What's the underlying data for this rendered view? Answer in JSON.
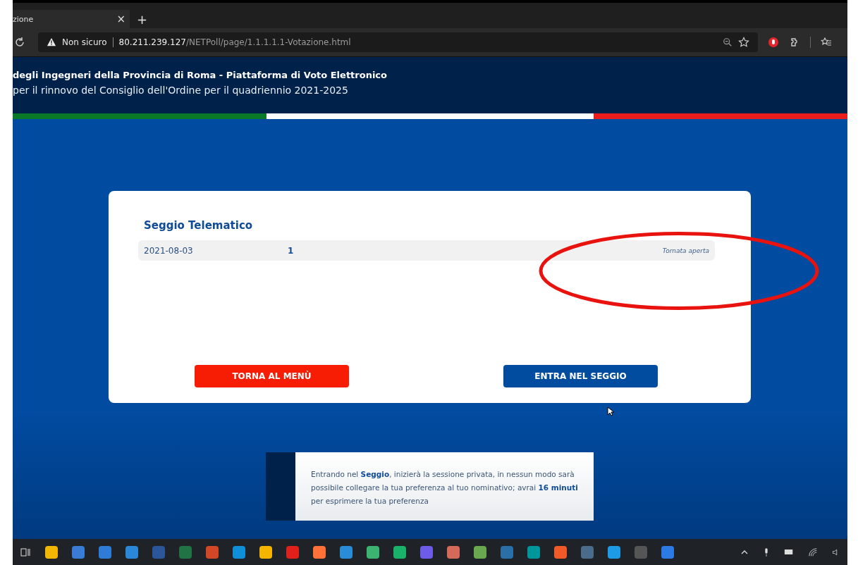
{
  "browser": {
    "tab_title": "zione",
    "tab_close": "×",
    "new_tab": "+",
    "security": "Non sicuro",
    "url_host": "80.211.239.127",
    "url_path": "/NETPoll/page/1.1.1.1.1-Votazione.html"
  },
  "header": {
    "title": "degli Ingegneri della Provincia di Roma - Piattaforma di Voto Elettronico",
    "subtitle": "per il rinnovo del Consiglio dell'Ordine per il quadriennio 2021-2025"
  },
  "card": {
    "title": "Seggio Telematico",
    "rows": [
      {
        "date": "2021-08-03",
        "number": "1",
        "status": "Tornata aperta"
      }
    ],
    "buttons": [
      {
        "label": "TORNA AL MENÙ",
        "kind": "back"
      },
      {
        "label": "ENTRA NEL SEGGIO",
        "kind": "primary"
      }
    ]
  },
  "notice": {
    "text": "Entrando nel **Seggio**, inizierà la sessione privata, in nessun modo sarà possibile collegare la tua preferenza al tuo nominativo; avrai **16 minuti** per esprimere la tua preferenza"
  }
}
